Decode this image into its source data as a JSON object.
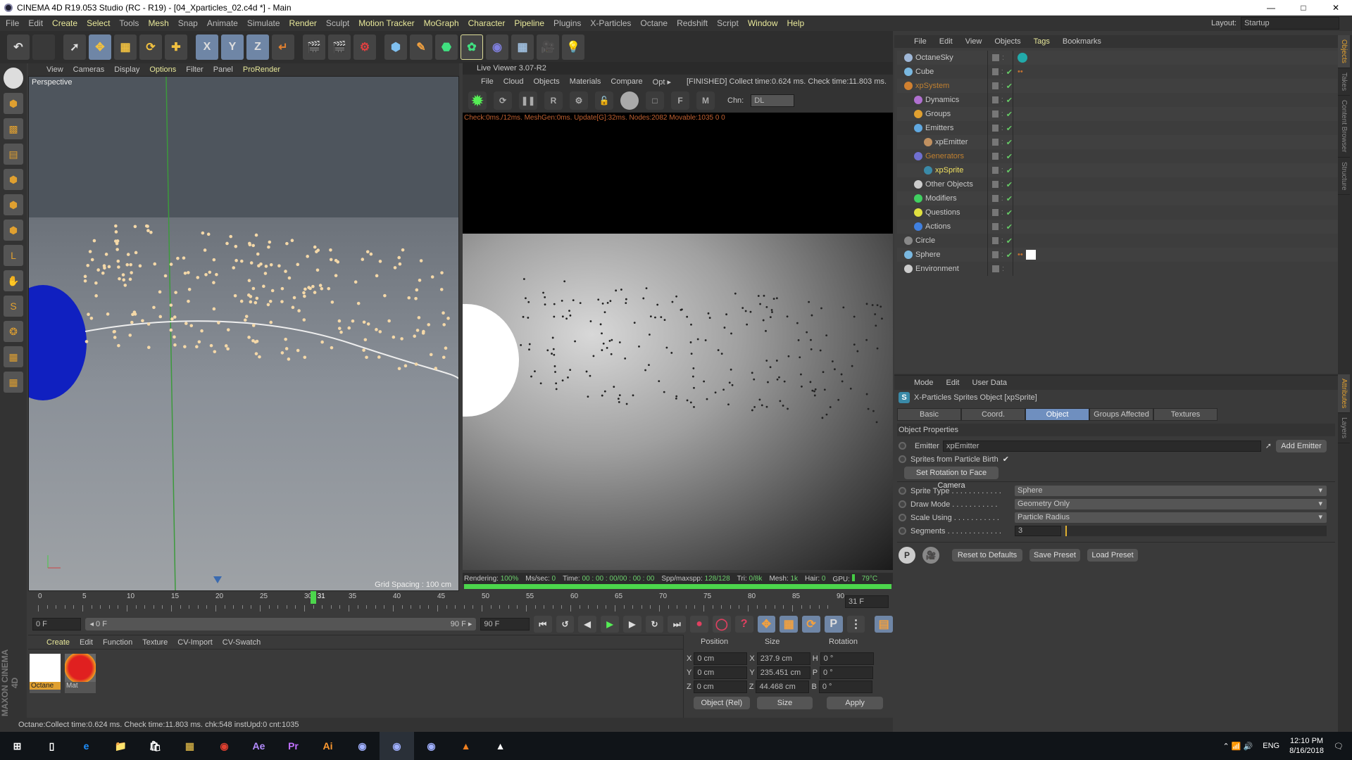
{
  "window": {
    "title": "CINEMA 4D R19.053 Studio (RC - R19) - [04_Xparticles_02.c4d *] - Main",
    "layout_label": "Layout:",
    "layout_value": "Startup"
  },
  "menu": [
    {
      "label": "File",
      "hl": false
    },
    {
      "label": "Edit",
      "hl": false
    },
    {
      "label": "Create",
      "hl": true
    },
    {
      "label": "Select",
      "hl": true
    },
    {
      "label": "Tools",
      "hl": false
    },
    {
      "label": "Mesh",
      "hl": true
    },
    {
      "label": "Snap",
      "hl": false
    },
    {
      "label": "Animate",
      "hl": false
    },
    {
      "label": "Simulate",
      "hl": false
    },
    {
      "label": "Render",
      "hl": true
    },
    {
      "label": "Sculpt",
      "hl": false
    },
    {
      "label": "Motion Tracker",
      "hl": true
    },
    {
      "label": "MoGraph",
      "hl": true
    },
    {
      "label": "Character",
      "hl": true
    },
    {
      "label": "Pipeline",
      "hl": true
    },
    {
      "label": "Plugins",
      "hl": false
    },
    {
      "label": "X-Particles",
      "hl": false
    },
    {
      "label": "Octane",
      "hl": false
    },
    {
      "label": "Redshift",
      "hl": false
    },
    {
      "label": "Script",
      "hl": false
    },
    {
      "label": "Window",
      "hl": true
    },
    {
      "label": "Help",
      "hl": true
    }
  ],
  "toolbar": {
    "axis_x": "X",
    "axis_y": "Y",
    "axis_z": "Z"
  },
  "viewport": {
    "menu": [
      "View",
      "Cameras",
      "Display",
      "Options",
      "Filter",
      "Panel",
      "ProRender"
    ],
    "label": "Perspective",
    "grid_spacing": "Grid Spacing : 100 cm"
  },
  "live_viewer": {
    "title": "Live Viewer 3.07-R2",
    "menu": [
      "File",
      "Cloud",
      "Objects",
      "Materials",
      "Compare",
      "Opt ▸"
    ],
    "status_text": "[FINISHED] Collect time:0.624 ms.  Check time:11.803 ms.",
    "channel_label": "Chn:",
    "channel_value": "DL",
    "stats": "Check:0ms./12ms. MeshGen:0ms. Update[G]:32ms. Nodes:2082 Movable:1035  0 0",
    "render_status": {
      "rendering_label": "Rendering:",
      "rendering": "100%",
      "ms_label": "Ms/sec:",
      "ms": "0",
      "time_label": "Time:",
      "time": "00 : 00 : 00/00 : 00 : 00",
      "spp_label": "Spp/maxspp:",
      "spp": "128/128",
      "tri_label": "Tri:",
      "tri": "0/8k",
      "mesh_label": "Mesh:",
      "mesh": "1k",
      "hair_label": "Hair:",
      "hair": "0",
      "gpu_label": "GPU:",
      "temp": "79°C"
    },
    "progress": 100
  },
  "timeline": {
    "ticks": [
      "0",
      "5",
      "10",
      "15",
      "20",
      "25",
      "30",
      "35",
      "40",
      "45",
      "50",
      "55",
      "60",
      "65",
      "70",
      "75",
      "80",
      "85",
      "90"
    ],
    "current": "31",
    "current_field": "31 F",
    "start": "0 F",
    "range_start": "◂ 0 F",
    "range_end": "90 F ▸",
    "end": "90 F"
  },
  "material_manager": {
    "menu": [
      "Create",
      "Edit",
      "Function",
      "Texture",
      "CV-Import",
      "CV-Swatch"
    ],
    "materials": [
      {
        "name": "Octane"
      },
      {
        "name": "Mat"
      }
    ]
  },
  "coord_manager": {
    "headers": [
      "Position",
      "Size",
      "Rotation"
    ],
    "rows": [
      {
        "axis": "X",
        "pos": "0 cm",
        "size_axis": "X",
        "size": "237.9 cm",
        "rot_axis": "H",
        "rot": "0 °"
      },
      {
        "axis": "Y",
        "pos": "0 cm",
        "size_axis": "Y",
        "size": "235.451 cm",
        "rot_axis": "P",
        "rot": "0 °"
      },
      {
        "axis": "Z",
        "pos": "0 cm",
        "size_axis": "Z",
        "size": "44.468 cm",
        "rot_axis": "B",
        "rot": "0 °"
      }
    ],
    "mode": "Object (Rel)",
    "size_mode": "Size",
    "apply": "Apply"
  },
  "status_bar": "Octane:Collect time:0.624 ms.  Check time:11.803 ms.  chk:548  instUpd:0  cnt:1035",
  "brand": "MAXON CINEMA 4D",
  "object_manager": {
    "menu": [
      "File",
      "Edit",
      "View",
      "Objects",
      "Tags",
      "Bookmarks"
    ],
    "objects": [
      {
        "name": "OctaneSky",
        "depth": 0,
        "color": "#a0b8d8",
        "check": false
      },
      {
        "name": "Cube",
        "depth": 0,
        "color": "#7ab8e0",
        "check": true
      },
      {
        "name": "xpSystem",
        "depth": 0,
        "color": "#d08030",
        "check": true,
        "orange": true
      },
      {
        "name": "Dynamics",
        "depth": 1,
        "color": "#b070d0",
        "check": true
      },
      {
        "name": "Groups",
        "depth": 1,
        "color": "#e0a030",
        "check": true
      },
      {
        "name": "Emitters",
        "depth": 1,
        "color": "#60a8e0",
        "check": true
      },
      {
        "name": "xpEmitter",
        "depth": 2,
        "color": "#c09060",
        "check": true
      },
      {
        "name": "Generators",
        "depth": 1,
        "color": "#7070d0",
        "check": true,
        "orange": true
      },
      {
        "name": "xpSprite",
        "depth": 2,
        "color": "#3a8aa8",
        "check": true,
        "yellow": true
      },
      {
        "name": "Other Objects",
        "depth": 1,
        "color": "#cccccc",
        "check": true
      },
      {
        "name": "Modifiers",
        "depth": 1,
        "color": "#40d060",
        "check": true
      },
      {
        "name": "Questions",
        "depth": 1,
        "color": "#e0e040",
        "check": true
      },
      {
        "name": "Actions",
        "depth": 1,
        "color": "#4080e0",
        "check": true
      },
      {
        "name": "Circle",
        "depth": 0,
        "color": "#888888",
        "check": true
      },
      {
        "name": "Sphere",
        "depth": 0,
        "color": "#7ab8e0",
        "check": true
      },
      {
        "name": "Environment",
        "depth": 0,
        "color": "#cccccc",
        "check": false
      }
    ]
  },
  "attributes": {
    "menu": [
      "Mode",
      "Edit",
      "User Data"
    ],
    "title": "X-Particles Sprites Object [xpSprite]",
    "tabs": [
      {
        "label": "Basic",
        "active": false
      },
      {
        "label": "Coord.",
        "active": false
      },
      {
        "label": "Object",
        "active": true
      },
      {
        "label": "Groups Affected",
        "active": false
      },
      {
        "label": "Textures",
        "active": false
      }
    ],
    "section": "Object Properties",
    "emitter_label": "Emitter",
    "emitter_value": "xpEmitter",
    "add_emitter": "Add Emitter",
    "birth_label": "Sprites from Particle Birth",
    "birth_checked": true,
    "face_camera": "Set Rotation to Face Camera",
    "params": [
      {
        "label": "Sprite Type . . . . . . . . . . . .",
        "value": "Sphere"
      },
      {
        "label": "Draw Mode . . . . . . . . . . .",
        "value": "Geometry Only"
      },
      {
        "label": "Scale Using . . . . . . . . . . .",
        "value": "Particle Radius"
      }
    ],
    "segments_label": "Segments . . . . . . . . . . . . .",
    "segments_value": "3",
    "reset": "Reset to Defaults",
    "save": "Save Preset",
    "load": "Load Preset"
  },
  "right_tabs": [
    {
      "label": "Objects",
      "on": true
    },
    {
      "label": "Takes",
      "on": false
    },
    {
      "label": "Content Browser",
      "on": false
    },
    {
      "label": "Structure",
      "on": false
    }
  ],
  "right_tabs_lower": [
    {
      "label": "Attributes",
      "on": true
    },
    {
      "label": "Layers",
      "on": false
    }
  ],
  "taskbar": {
    "apps": [
      "Ae",
      "Pr",
      "Ai"
    ],
    "lang": "ENG",
    "time": "12:10 PM",
    "date": "8/16/2018"
  },
  "colors": {
    "accent": "#6f8fbf",
    "highlight_menu": "#e8e89a",
    "progress": "#4cd64c",
    "selected_orange": "#d08030"
  }
}
